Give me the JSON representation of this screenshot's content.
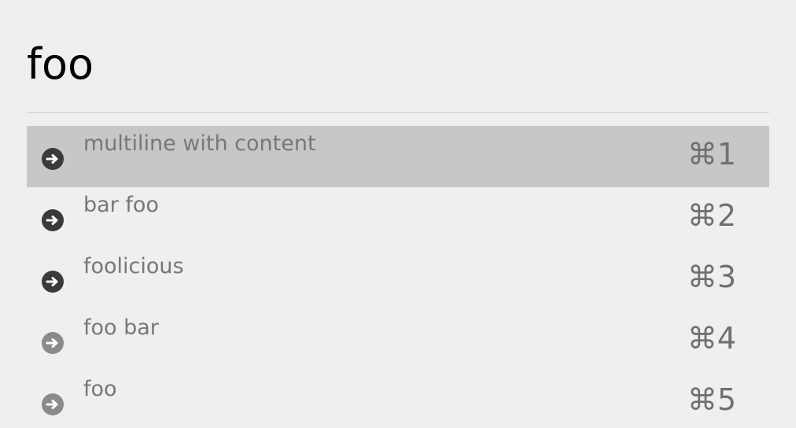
{
  "search": {
    "query": "foo"
  },
  "results": [
    {
      "label": "multiline with content",
      "shortcut": "⌘1",
      "icon": "arrow-right-circle-icon",
      "selected": true,
      "icon_color": "#3a3a3a"
    },
    {
      "label": "bar foo",
      "shortcut": "⌘2",
      "icon": "arrow-right-circle-icon",
      "selected": false,
      "icon_color": "#3a3a3a"
    },
    {
      "label": "foolicious",
      "shortcut": "⌘3",
      "icon": "arrow-right-circle-icon",
      "selected": false,
      "icon_color": "#3a3a3a"
    },
    {
      "label": "foo bar",
      "shortcut": "⌘4",
      "icon": "arrow-right-circle-icon",
      "selected": false,
      "icon_color": "#8a8a8a"
    },
    {
      "label": "foo",
      "shortcut": "⌘5",
      "icon": "arrow-right-circle-icon",
      "selected": false,
      "icon_color": "#8a8a8a"
    }
  ],
  "colors": {
    "background": "#efefef",
    "selected_row": "#c7c7c7",
    "divider": "#dadada",
    "label_text": "#777777",
    "shortcut_text": "#707070"
  }
}
